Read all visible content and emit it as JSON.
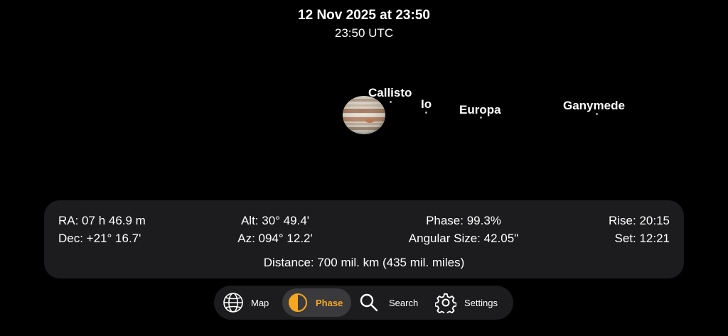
{
  "header": {
    "date": "12 Nov 2025 at 23:50",
    "utc": "23:50 UTC"
  },
  "moons": [
    {
      "name": "Callisto"
    },
    {
      "name": "Io"
    },
    {
      "name": "Europa"
    },
    {
      "name": "Ganymede"
    }
  ],
  "info": {
    "ra": "RA: 07 h 46.9 m",
    "dec": "Dec: +21° 16.7'",
    "alt": "Alt: 30° 49.4'",
    "az": "Az: 094° 12.2'",
    "phase": "Phase: 99.3%",
    "angular_size": "Angular Size: 42.05\"",
    "rise": "Rise: 20:15",
    "set": "Set: 12:21",
    "distance": "Distance: 700 mil. km (435 mil. miles)"
  },
  "toolbar": {
    "map_label": "Map",
    "phase_label": "Phase",
    "search_label": "Search",
    "settings_label": "Settings",
    "active": "phase"
  },
  "colors": {
    "accent": "#f5a623",
    "panel": "#1c1c1e",
    "active_tab": "#3a3a3c"
  }
}
